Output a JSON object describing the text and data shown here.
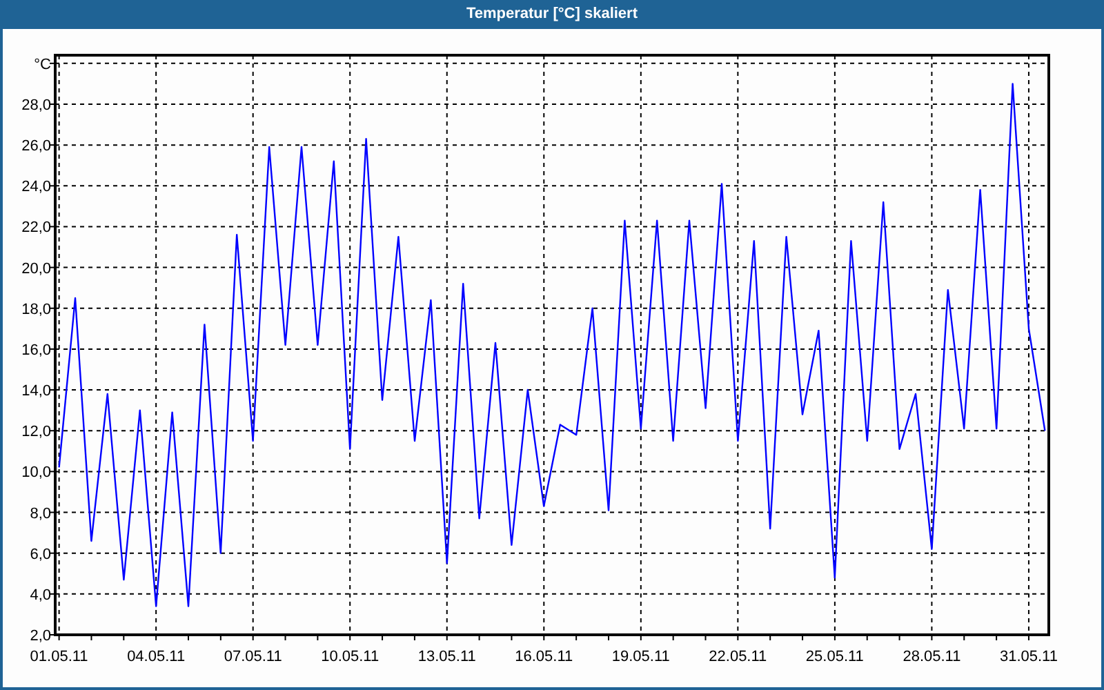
{
  "window": {
    "title": "Temperatur [°C] skaliert"
  },
  "chart": {
    "chart_data": {
      "type": "line",
      "categories": [
        "01.05.11",
        null,
        null,
        null,
        null,
        null,
        "04.05.11",
        null,
        null,
        null,
        null,
        null,
        "07.05.11",
        null,
        null,
        null,
        null,
        null,
        "10.05.11",
        null,
        null,
        null,
        null,
        null,
        "13.05.11",
        null,
        null,
        null,
        null,
        null,
        "16.05.11",
        null,
        null,
        null,
        null,
        null,
        "19.05.11",
        null,
        null,
        null,
        null,
        null,
        "22.05.11",
        null,
        null,
        null,
        null,
        null,
        "25.05.11",
        null,
        null,
        null,
        null,
        null,
        "28.05.11",
        null,
        null,
        null,
        null,
        null,
        "31.05.11",
        null
      ],
      "series": [
        {
          "color": "#0000ff",
          "values": [
            10.2,
            18.5,
            6.6,
            13.8,
            4.7,
            13.0,
            3.4,
            12.9,
            3.4,
            17.2,
            6.0,
            21.6,
            11.5,
            25.9,
            16.2,
            25.9,
            16.2,
            25.2,
            11.1,
            26.3,
            13.5,
            21.5,
            11.5,
            18.4,
            5.5,
            19.2,
            7.7,
            16.3,
            6.4,
            14.0,
            8.3,
            12.3,
            11.8,
            18.0,
            8.1,
            22.3,
            12.1,
            22.3,
            11.5,
            22.3,
            13.1,
            24.1,
            11.5,
            21.3,
            7.2,
            21.5,
            12.8,
            16.9,
            4.8,
            21.3,
            11.5,
            23.2,
            11.1,
            13.8,
            6.2,
            18.9,
            12.1,
            23.8,
            12.1,
            29.0,
            17.0,
            12.0
          ]
        }
      ],
      "grid": true,
      "ylim": [
        2,
        30.4
      ],
      "yticks": [
        {
          "value": 2,
          "label": "2,0"
        },
        {
          "value": 4,
          "label": "4,0"
        },
        {
          "value": 6,
          "label": "6,0"
        },
        {
          "value": 8,
          "label": "8,0"
        },
        {
          "value": 10,
          "label": "10,0"
        },
        {
          "value": 12,
          "label": "12,0"
        },
        {
          "value": 14,
          "label": "14,0"
        },
        {
          "value": 16,
          "label": "16,0"
        },
        {
          "value": 18,
          "label": "18,0"
        },
        {
          "value": 20,
          "label": "20,0"
        },
        {
          "value": 22,
          "label": "22,0"
        },
        {
          "value": 24,
          "label": "24,0"
        },
        {
          "value": 26,
          "label": "26,0"
        },
        {
          "value": 28,
          "label": "28,0"
        },
        {
          "value": 30,
          "label": "°C"
        }
      ]
    }
  }
}
